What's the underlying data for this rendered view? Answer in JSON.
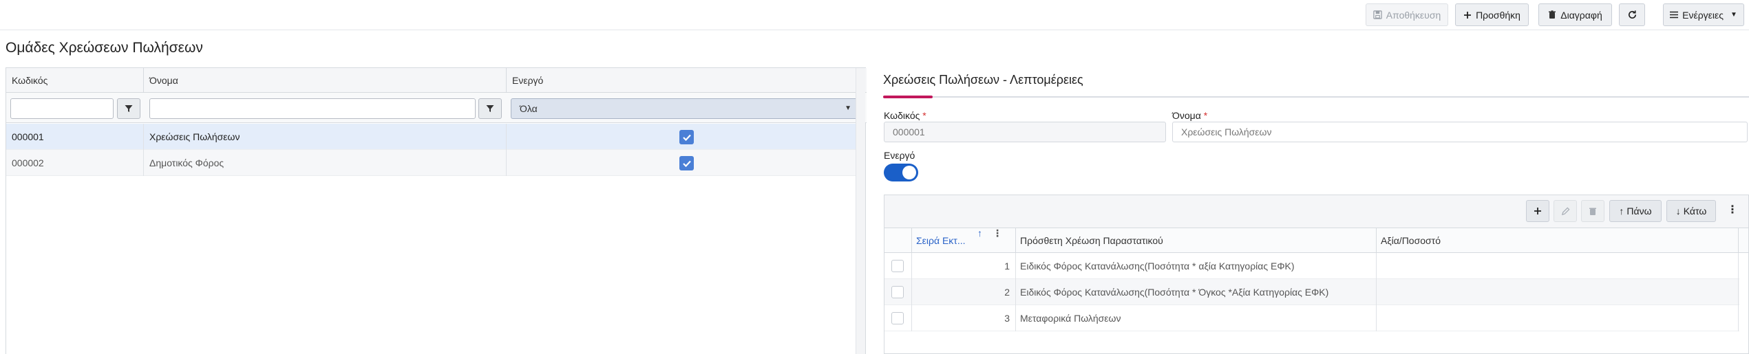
{
  "toolbar": {
    "save_label": "Αποθήκευση",
    "add_label": "Προσθήκη",
    "delete_label": "Διαγραφή",
    "actions_label": "Ενέργειες"
  },
  "left": {
    "title": "Ομάδες Χρεώσεων Πωλήσεων",
    "columns": [
      "Κωδικός",
      "Όνομα",
      "Ενεργό"
    ],
    "filter": {
      "code_value": "",
      "name_value": "",
      "active_selected": "Όλα"
    },
    "rows": [
      {
        "code": "000001",
        "name": "Χρεώσεις Πωλήσεων",
        "active": true,
        "selected": true
      },
      {
        "code": "000002",
        "name": "Δημοτικός Φόρος",
        "active": true,
        "selected": false
      }
    ]
  },
  "detail": {
    "title": "Χρεώσεις Πωλήσεων - Λεπτομέρειες",
    "code_label": "Κωδικός",
    "code_value": "000001",
    "name_label": "Όνομα",
    "name_value": "Χρεώσεις Πωλήσεων",
    "required_mark": "*",
    "active_label": "Ενεργό",
    "active_on": true
  },
  "subgrid": {
    "up_label": "Πάνω",
    "down_label": "Κάτω",
    "columns": [
      "Σειρά Εκτ...",
      "Πρόσθετη Χρέωση Παραστατικού",
      "Αξία/Ποσοστό"
    ],
    "rows": [
      {
        "order": "1",
        "charge": "Ειδικός Φόρος Κατανάλωσης(Ποσότητα * αξία Κατηγορίας ΕΦΚ)",
        "value": ""
      },
      {
        "order": "2",
        "charge": "Ειδικός Φόρος Κατανάλωσης(Ποσότητα * Όγκος *Αξία Κατηγορίας ΕΦΚ)",
        "value": ""
      },
      {
        "order": "3",
        "charge": "Μεταφορικά Πωλήσεων",
        "value": ""
      }
    ]
  },
  "colors": {
    "accent": "#c2185b",
    "primary": "#1a5fc8",
    "checkbox": "#4a7fd6",
    "selected_row": "#e4edfa"
  }
}
